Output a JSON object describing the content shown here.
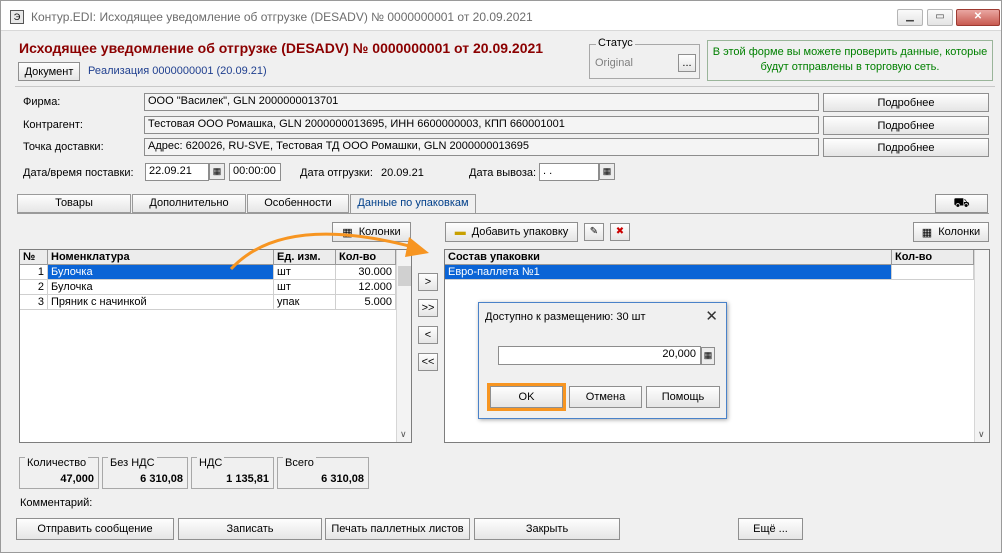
{
  "window": {
    "title": "Контур.EDI: Исходящее уведомление об отгрузке (DESADV) № 0000000001 от 20.09.2021",
    "minimize": "▁",
    "maximize": "▭",
    "close": "✕"
  },
  "header": {
    "heading": "Исходящее уведомление об отгрузке (DESADV) № 0000000001 от 20.09.2021",
    "document_button": "Документ",
    "reference_link": "Реализация  0000000001 (20.09.21)",
    "status_label": "Статус",
    "status_value": "Original",
    "status_button": "...",
    "info_text": "В этой форме вы можете проверить данные, которые будут отправлены в торговую сеть."
  },
  "fields": {
    "firm_label": "Фирма:",
    "firm_value": "ООО \"Василек\", GLN 2000000013701",
    "counterparty_label": "Контрагент:",
    "counterparty_value": "Тестовая ООО Ромашка, GLN 2000000013695, ИНН 6600000003, КПП 660001001",
    "delivery_point_label": "Точка доставки:",
    "delivery_point_value": "Адрес: 620026, RU-SVE, Тестовая ТД ООО Ромашки, GLN 2000000013695",
    "more_button": "Подробнее",
    "delivery_datetime_label": "Дата/время поставки:",
    "delivery_date": "22.09.21",
    "delivery_time": "00:00:00",
    "shipping_date_label": "Дата отгрузки:",
    "shipping_date": "20.09.21",
    "pickup_date_label": "Дата вывоза:",
    "pickup_date": " .  ."
  },
  "tabs": [
    {
      "label": "Товары"
    },
    {
      "label": "Дополнительно"
    },
    {
      "label": "Особенности"
    },
    {
      "label": "Данные по упаковкам"
    }
  ],
  "left_grid": {
    "columns_button": "Колонки",
    "headers": [
      "№",
      "Номенклатура",
      "Ед. изм.",
      "Кол-во"
    ],
    "rows": [
      {
        "n": "1",
        "name": "Булочка",
        "unit": "шт",
        "qty": "30.000"
      },
      {
        "n": "2",
        "name": "Булочка",
        "unit": "шт",
        "qty": "12.000"
      },
      {
        "n": "3",
        "name": "Пряник с начинкой",
        "unit": "упак",
        "qty": "5.000"
      }
    ]
  },
  "transfer_buttons": [
    ">",
    ">>",
    "<",
    "<<"
  ],
  "right_grid": {
    "add_package_button": "Добавить упаковку",
    "columns_button": "Колонки",
    "headers": [
      "Состав упаковки",
      "Кол-во"
    ],
    "rows": [
      {
        "name": "Евро-паллета №1",
        "qty": ""
      }
    ]
  },
  "summary": [
    {
      "label": "Количество",
      "value": "47,000"
    },
    {
      "label": "Без НДС",
      "value": "6 310,08"
    },
    {
      "label": "НДС",
      "value": "1 135,81"
    },
    {
      "label": "Всего",
      "value": "6 310,08"
    }
  ],
  "comment_label": "Комментарий:",
  "bottom_buttons": {
    "send": "Отправить сообщение",
    "save": "Записать",
    "print": "Печать паллетных листов",
    "close": "Закрыть",
    "more": "Ещё ..."
  },
  "dialog": {
    "title": "Доступно к размещению: 30 шт",
    "value": "20,000",
    "ok": "OK",
    "cancel": "Отмена",
    "help": "Помощь"
  },
  "colors": {
    "heading": "#8b0000",
    "selection": "#0a64d6",
    "highlight": "#f79521",
    "info_text": "#008000"
  }
}
